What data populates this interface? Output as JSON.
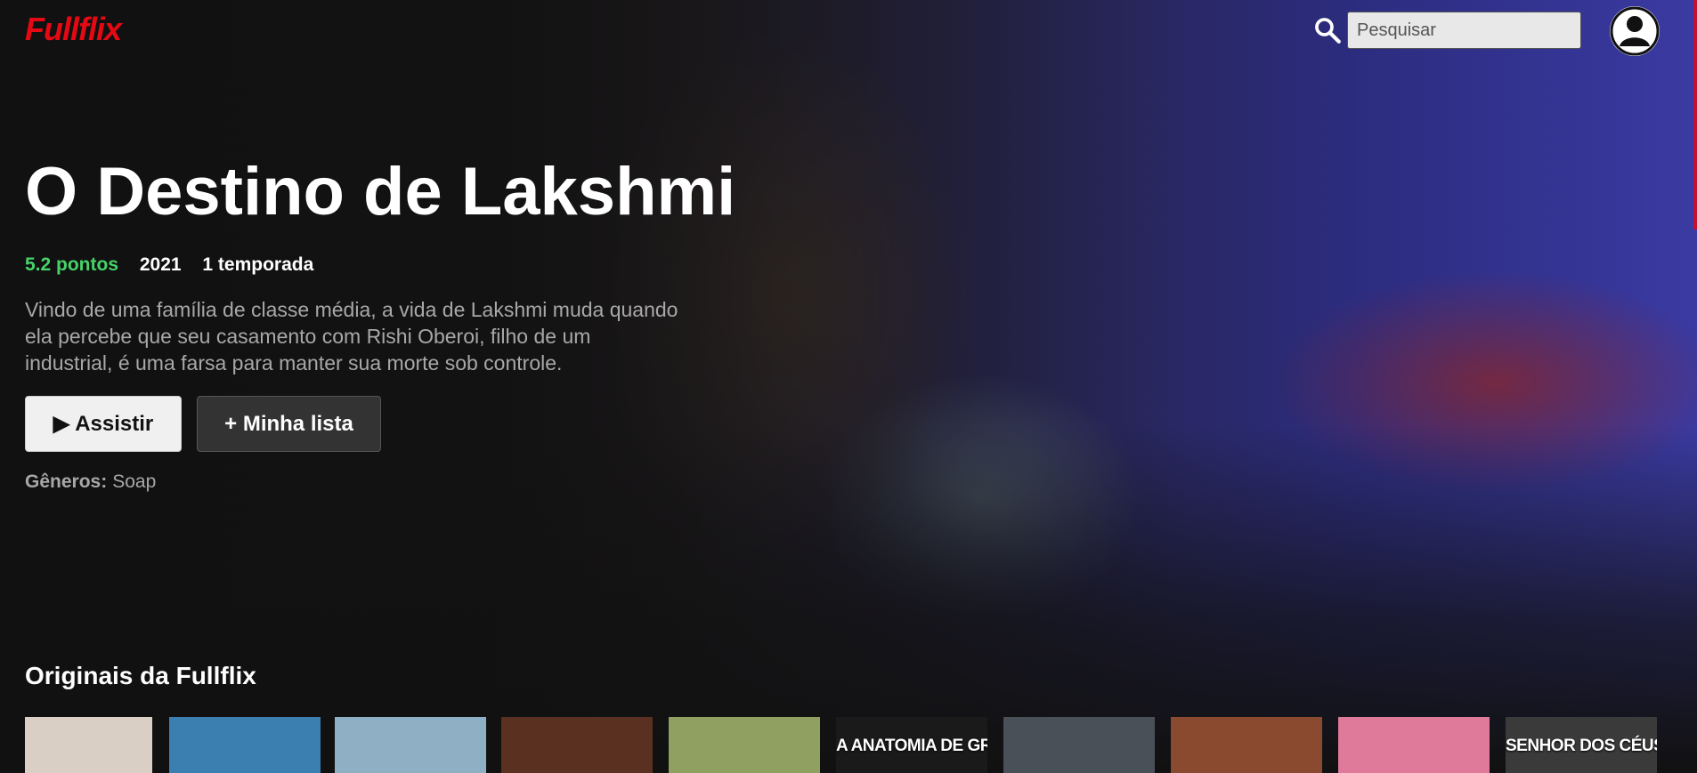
{
  "header": {
    "logo": "Fullflix",
    "search_placeholder": "Pesquisar"
  },
  "featured": {
    "title": "O Destino de Lakshmi",
    "score": "5.2 pontos",
    "year": "2021",
    "seasons": "1 temporada",
    "description": "Vindo de uma família de classe média, a vida de Lakshmi muda quando ela percebe que seu casamento com Rishi Oberoi, filho de um industrial, é uma farsa para manter sua morte sob controle.",
    "play_glyph": "▶",
    "play_label": "Assistir",
    "list_label": "+ Minha lista",
    "genres_label": "Gêneros:",
    "genres_value": "Soap"
  },
  "row": {
    "title": "Originais da Fullflix",
    "items": [
      {
        "caption": "",
        "color": "#d9cfc4"
      },
      {
        "caption": "",
        "color": "#3b7fb0"
      },
      {
        "caption": "",
        "color": "#8fb0c4"
      },
      {
        "caption": "",
        "color": "#5a3020"
      },
      {
        "caption": "",
        "color": "#8fa060"
      },
      {
        "caption": "A ANATOMIA DE GREY",
        "color": "#1a1a1a"
      },
      {
        "caption": "",
        "color": "#4a5058"
      },
      {
        "caption": "",
        "color": "#8a4a30"
      },
      {
        "caption": "",
        "color": "#e07a9a"
      },
      {
        "caption": "SENHOR DOS CÉUS",
        "color": "#3a3a3a"
      }
    ]
  }
}
